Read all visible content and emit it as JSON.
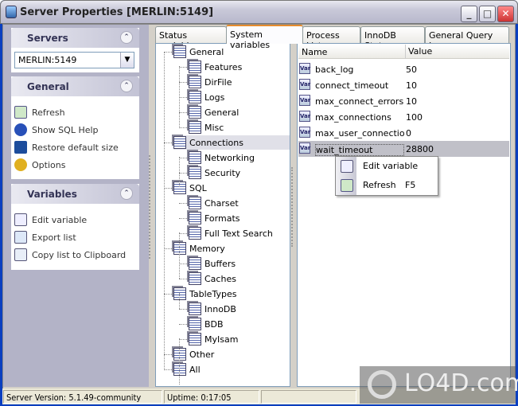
{
  "window": {
    "title": "Server Properties [MERLIN:5149]",
    "minimize": "_",
    "maximize": "□",
    "close": "✕"
  },
  "sidebar": {
    "servers": {
      "title": "Servers",
      "selected": "MERLIN:5149"
    },
    "general": {
      "title": "General",
      "items": [
        {
          "label": "Refresh",
          "icon": "refresh-icon"
        },
        {
          "label": "Show SQL Help",
          "icon": "help-icon"
        },
        {
          "label": "Restore default size",
          "icon": "restore-size-icon"
        },
        {
          "label": "Options",
          "icon": "options-icon"
        }
      ]
    },
    "variables": {
      "title": "Variables",
      "items": [
        {
          "label": "Edit variable",
          "icon": "edit-icon"
        },
        {
          "label": "Export list",
          "icon": "export-icon"
        },
        {
          "label": "Copy list to Clipboard",
          "icon": "copy-icon"
        }
      ]
    }
  },
  "tabs": [
    "Status variables",
    "System variables",
    "Process List",
    "InnoDB Status",
    "General Query Log"
  ],
  "active_tab": "System variables",
  "tree": [
    {
      "label": "General",
      "level": 0
    },
    {
      "label": "Features",
      "level": 1
    },
    {
      "label": "DirFile",
      "level": 1
    },
    {
      "label": "Logs",
      "level": 1
    },
    {
      "label": "General",
      "level": 1
    },
    {
      "label": "Misc",
      "level": 1
    },
    {
      "label": "Connections",
      "level": 0,
      "selected": true
    },
    {
      "label": "Networking",
      "level": 1
    },
    {
      "label": "Security",
      "level": 1
    },
    {
      "label": "SQL",
      "level": 0
    },
    {
      "label": "Charset",
      "level": 1
    },
    {
      "label": "Formats",
      "level": 1
    },
    {
      "label": "Full Text Search",
      "level": 1
    },
    {
      "label": "Memory",
      "level": 0
    },
    {
      "label": "Buffers",
      "level": 1
    },
    {
      "label": "Caches",
      "level": 1
    },
    {
      "label": "TableTypes",
      "level": 0
    },
    {
      "label": "InnoDB",
      "level": 1
    },
    {
      "label": "BDB",
      "level": 1
    },
    {
      "label": "MyIsam",
      "level": 1
    },
    {
      "label": "Other",
      "level": 0
    },
    {
      "label": "All",
      "level": 0
    }
  ],
  "list": {
    "columns": [
      "Name",
      "Value"
    ],
    "icon_text": "Var",
    "rows": [
      {
        "name": "back_log",
        "value": "50"
      },
      {
        "name": "connect_timeout",
        "value": "10"
      },
      {
        "name": "max_connect_errors",
        "value": "10"
      },
      {
        "name": "max_connections",
        "value": "100"
      },
      {
        "name": "max_user_connections",
        "value": "0"
      },
      {
        "name": "wait_timeout",
        "value": "28800",
        "selected": true
      }
    ]
  },
  "context_menu": [
    {
      "label": "Edit variable",
      "shortcut": ""
    },
    {
      "label": "Refresh",
      "shortcut": "F5"
    }
  ],
  "status": {
    "version": "Server Version: 5.1.49-community",
    "uptime": "Uptime: 0:17:05"
  },
  "watermark": "LO4D.com"
}
